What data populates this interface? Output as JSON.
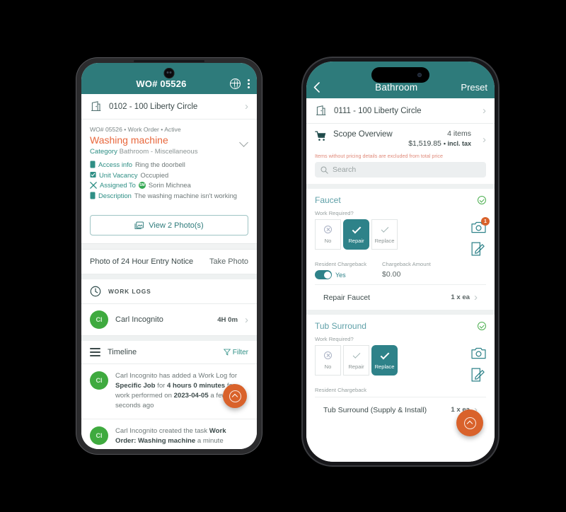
{
  "left_phone": {
    "appbar": {
      "title": "WO# 05526",
      "back_icon": "chevron-left-icon",
      "globe_icon": "globe-icon",
      "overflow_icon": "kebab-menu-icon"
    },
    "property_row": {
      "icon": "building-icon",
      "label": "0102 - 100 Liberty Circle",
      "chevron": "›"
    },
    "work_order": {
      "meta": "WO# 05526 • Work Order • Active",
      "title": "Washing machine",
      "category_label": "Category",
      "category_value": "Bathroom - Miscellaneous",
      "details": [
        {
          "icon": "note-icon",
          "label": "Access info",
          "value": "Ring the doorbell"
        },
        {
          "icon": "checkbox-icon",
          "label": "Unit Vacancy",
          "value": "Occupied"
        },
        {
          "icon": "tools-icon",
          "label": "Assigned To",
          "value": "Sorin Michnea",
          "avatar": "SM"
        },
        {
          "icon": "note-icon",
          "label": "Description",
          "value": "The washing machine isn't working"
        }
      ],
      "photo_button": {
        "icon": "image-icon",
        "label": "View 2 Photo(s)"
      }
    },
    "entry_notice": {
      "label": "Photo of 24 Hour Entry Notice",
      "action": "Take Photo"
    },
    "work_logs": {
      "icon": "clock-icon",
      "header": "WORK LOGS",
      "entries": [
        {
          "avatar": "CI",
          "name": "Carl Incognito",
          "duration": "4H 0m",
          "chevron": "›"
        }
      ]
    },
    "timeline": {
      "icon": "list-icon",
      "title": "Timeline",
      "filter_icon": "funnel-icon",
      "filter_label": "Filter",
      "items": [
        {
          "avatar": "CI",
          "html": "Carl Incognito has added a Work Log for <b>Specific Job</b> for <b>4 hours 0 minutes</b> for work performed on <b>2023-04-05</b> a few seconds ago"
        },
        {
          "avatar": "CI",
          "html": "Carl Incognito created the task <b>Work Order: Washing machine</b> a minute"
        }
      ]
    },
    "fab": {
      "icon": "chevron-up-circle-icon"
    }
  },
  "right_phone": {
    "appbar": {
      "title": "Bathroom",
      "back_icon": "chevron-left-icon",
      "action_label": "Preset"
    },
    "property_row": {
      "icon": "building-icon",
      "label": "0111 - 100 Liberty Circle",
      "chevron": "›"
    },
    "scope_overview": {
      "icon": "cart-icon",
      "label": "Scope Overview",
      "items_count": "4 items",
      "price": "$1,519.85",
      "price_suffix": "• incl. tax",
      "chevron": "›"
    },
    "pricing_note": "Items without pricing details are excluded from total price",
    "search": {
      "icon": "search-icon",
      "placeholder": "Search"
    },
    "sections": [
      {
        "title": "Faucet",
        "status_icon": "check-circle-icon",
        "work_required_label": "Work Required?",
        "options": [
          {
            "label": "No",
            "glyph": "x-circle-icon",
            "selected": false
          },
          {
            "label": "Repair",
            "glyph": "check-icon",
            "selected": true
          },
          {
            "label": "Replace",
            "glyph": "check-icon",
            "selected": false
          }
        ],
        "camera_icon": "camera-icon",
        "camera_badge": "1",
        "edit_icon": "edit-icon",
        "chargeback_label": "Resident Chargeback",
        "chargeback_toggle": "Yes",
        "chargeback_amount_label": "Chargeback Amount",
        "chargeback_amount": "$0.00",
        "items": [
          {
            "name": "Repair Faucet",
            "qty": "1 x ea",
            "chevron": "›"
          }
        ]
      },
      {
        "title": "Tub Surround",
        "status_icon": "check-circle-icon",
        "work_required_label": "Work Required?",
        "options": [
          {
            "label": "No",
            "glyph": "x-circle-icon",
            "selected": false
          },
          {
            "label": "Repair",
            "glyph": "check-icon",
            "selected": false
          },
          {
            "label": "Replace",
            "glyph": "check-icon",
            "selected": true
          }
        ],
        "camera_icon": "camera-icon",
        "camera_badge": "",
        "edit_icon": "edit-icon",
        "chargeback_label": "Resident Chargeback",
        "items": [
          {
            "name": "Tub Surround (Supply & Install)",
            "qty": "1 x ea",
            "chevron": "›"
          }
        ]
      }
    ],
    "fab": {
      "icon": "chevron-up-circle-icon"
    }
  },
  "colors": {
    "teal": "#2e7b7b",
    "teal_select": "#2e8289",
    "orange": "#d9622b",
    "title_orange": "#e8673c",
    "green": "#3faa3f",
    "note_red": "#e08a7a"
  }
}
